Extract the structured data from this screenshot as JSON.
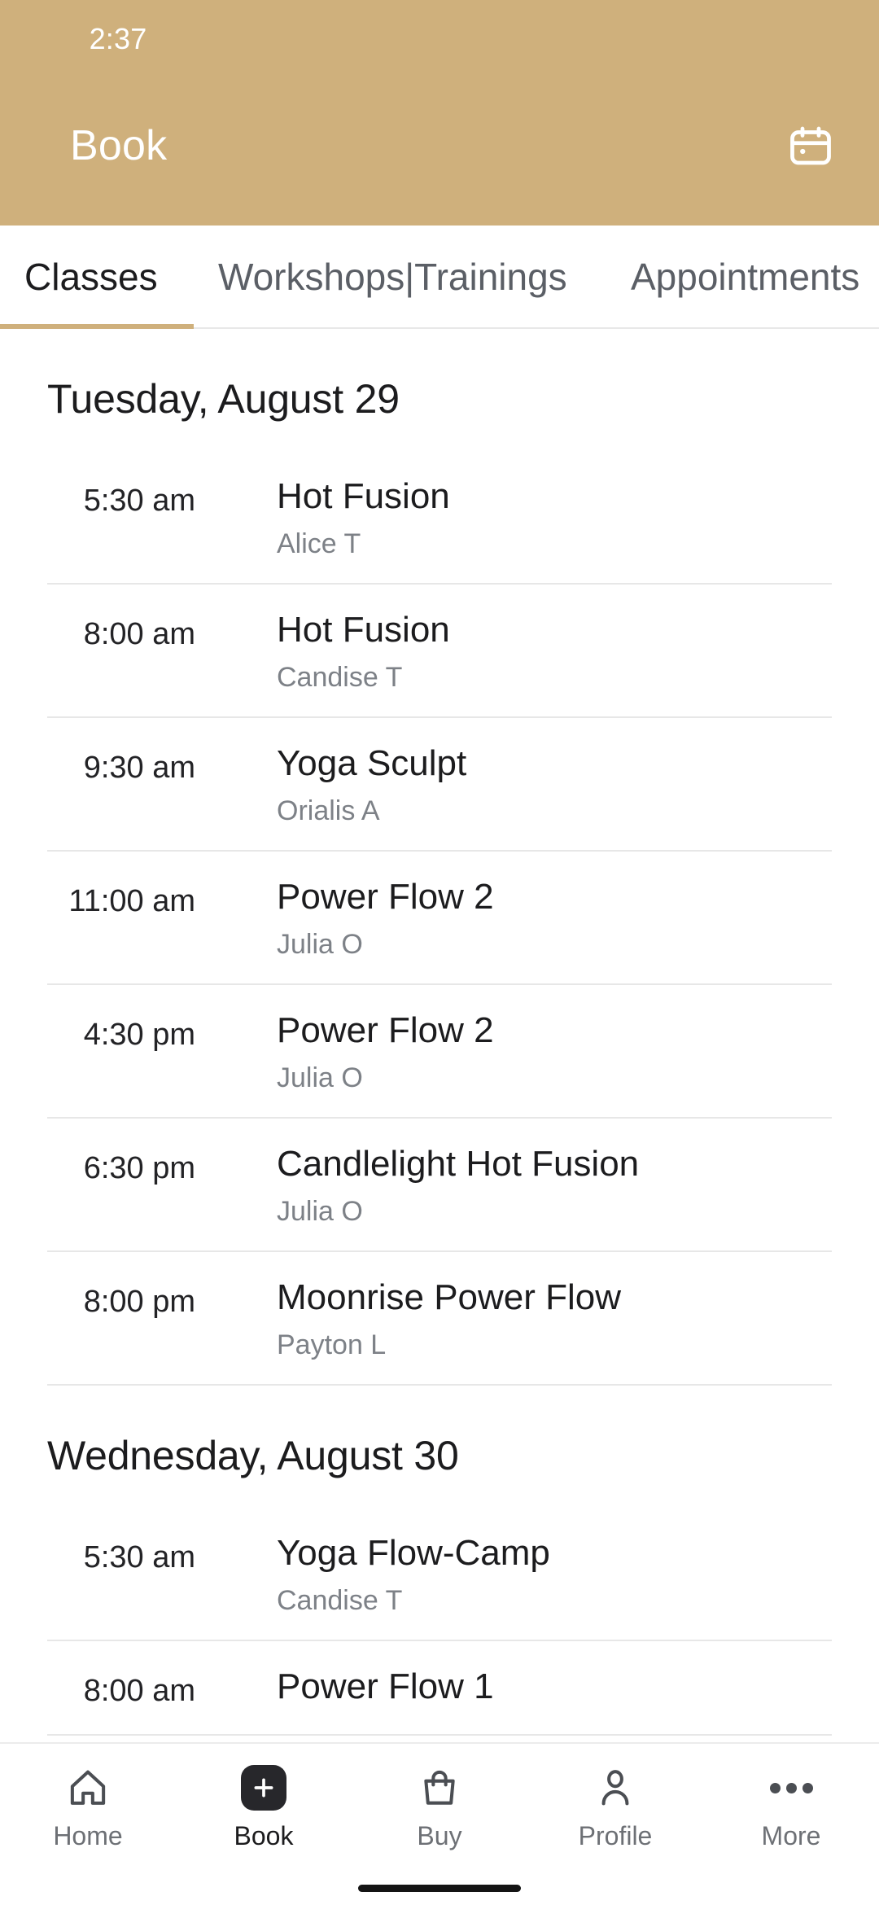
{
  "status_bar": {
    "time": "2:37"
  },
  "app_bar": {
    "title": "Book",
    "action_icon": "calendar-icon"
  },
  "theme": {
    "accent": "#CFB07C",
    "text_primary": "#1C1C1E",
    "text_secondary": "#7D8187",
    "divider": "#E7E7E7",
    "nav_active": "#27272B"
  },
  "tabs": [
    {
      "label": "Classes",
      "active": true
    },
    {
      "label": "Workshops|Trainings",
      "active": false
    },
    {
      "label": "Appointments",
      "active": false
    }
  ],
  "schedule": [
    {
      "date": "Tuesday, August 29",
      "classes": [
        {
          "time": "5:30 am",
          "name": "Hot Fusion",
          "instructor": "Alice T"
        },
        {
          "time": "8:00 am",
          "name": "Hot Fusion",
          "instructor": "Candise T"
        },
        {
          "time": "9:30 am",
          "name": "Yoga Sculpt",
          "instructor": "Orialis A"
        },
        {
          "time": "11:00 am",
          "name": "Power Flow 2",
          "instructor": "Julia O"
        },
        {
          "time": "4:30 pm",
          "name": "Power Flow 2",
          "instructor": "Julia O"
        },
        {
          "time": "6:30 pm",
          "name": "Candlelight Hot Fusion",
          "instructor": "Julia O"
        },
        {
          "time": "8:00 pm",
          "name": "Moonrise Power Flow",
          "instructor": "Payton L"
        }
      ]
    },
    {
      "date": "Wednesday, August 30",
      "classes": [
        {
          "time": "5:30 am",
          "name": "Yoga Flow-Camp",
          "instructor": "Candise T"
        },
        {
          "time": "8:00 am",
          "name": "Power Flow 1",
          "instructor": ""
        }
      ]
    }
  ],
  "bottom_nav": [
    {
      "label": "Home",
      "icon": "home-icon",
      "active": false
    },
    {
      "label": "Book",
      "icon": "plus-square-icon",
      "active": true
    },
    {
      "label": "Buy",
      "icon": "shopping-bag-icon",
      "active": false
    },
    {
      "label": "Profile",
      "icon": "person-icon",
      "active": false
    },
    {
      "label": "More",
      "icon": "ellipsis-icon",
      "active": false
    }
  ]
}
